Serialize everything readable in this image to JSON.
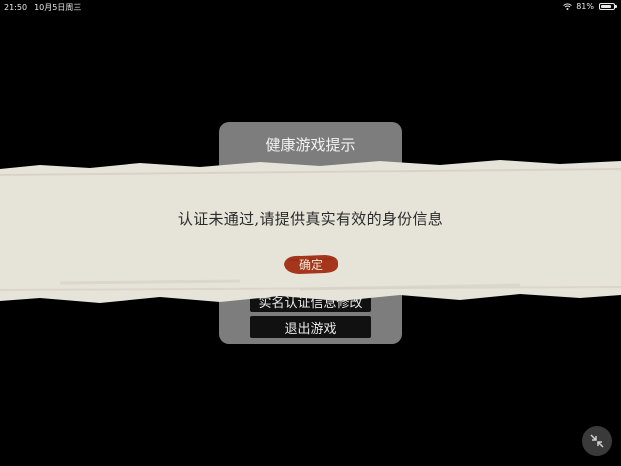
{
  "status_bar": {
    "time": "21:50",
    "date": "10月5日周三",
    "battery_percent": "81%",
    "battery_level": 0.81
  },
  "health_panel": {
    "title": "健康游戏提示",
    "modify_button": "实名认证信息修改",
    "exit_button": "退出游戏"
  },
  "dialog": {
    "message": "认证未通过,请提供真实有效的身份信息",
    "confirm_label": "确定",
    "confirm_color": "#a5351b",
    "strip_color": "#e6e3d9"
  },
  "icons": {
    "wifi": "wifi-icon",
    "battery": "battery-icon",
    "exit_fullscreen": "collapse-arrows-icon"
  }
}
